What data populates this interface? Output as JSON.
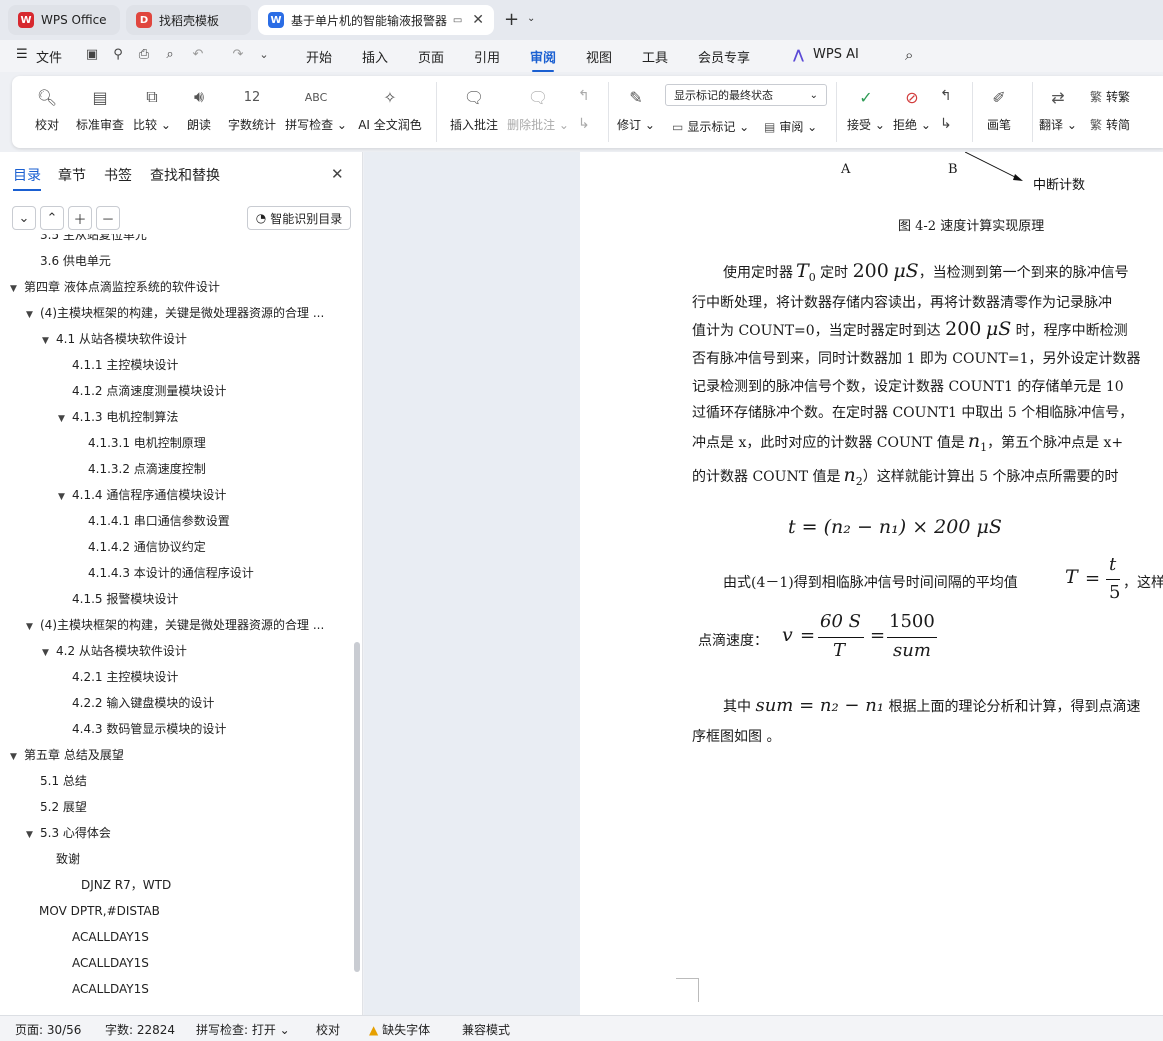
{
  "tabs": [
    {
      "label": "WPS Office",
      "icon": "W",
      "color": "#d7282f"
    },
    {
      "label": "找稻壳模板",
      "icon": "D",
      "color": "#e0463e"
    },
    {
      "label": "基于单片机的智能输液报警器",
      "icon": "W",
      "color": "#2b6de5"
    }
  ],
  "menu": {
    "file": "文件",
    "items": [
      "开始",
      "插入",
      "页面",
      "引用",
      "审阅",
      "视图",
      "工具",
      "会员专享"
    ],
    "active": "审阅",
    "ai": "WPS AI"
  },
  "ribbon": {
    "proofread": "校对",
    "standard_review": "标准审查",
    "compare": "比较",
    "read_aloud": "朗读",
    "word_count": "字数统计",
    "spell_check": "拼写检查",
    "ai_polish": "AI 全文润色",
    "insert_comment": "插入批注",
    "delete_comment": "删除批注",
    "revise": "修订",
    "track_mode": "显示标记的最终状态",
    "show_markup": "显示标记",
    "review": "审阅",
    "accept": "接受",
    "reject": "拒绝",
    "pen": "画笔",
    "translate": "翻译",
    "to_traditional": "转繁",
    "to_simplified": "转简"
  },
  "sidebar": {
    "tabs": [
      "目录",
      "章节",
      "书签",
      "查找和替换"
    ],
    "smart_toc": "智能识别目录",
    "toc": [
      {
        "text": "3.5  主从站复位单元",
        "level": 2
      },
      {
        "text": "3.6 供电单元",
        "level": 2
      },
      {
        "text": "第四章      液体点滴监控系统的软件设计",
        "level": 1,
        "arrow": "down"
      },
      {
        "text": "(4)主模块框架的构建，关键是微处理器资源的合理 ...",
        "level": 2,
        "arrow": "down"
      },
      {
        "text": "4.1 从站各模块软件设计",
        "level": 3,
        "arrow": "down"
      },
      {
        "text": "4.1.1 主控模块设计",
        "level": 4
      },
      {
        "text": "4.1.2 点滴速度测量模块设计",
        "level": 4
      },
      {
        "text": "4.1.3 电机控制算法",
        "level": 4,
        "arrow": "down"
      },
      {
        "text": "4.1.3.1  电机控制原理",
        "level": 5
      },
      {
        "text": "4.1.3.2 点滴速度控制",
        "level": 5
      },
      {
        "text": "4.1.4 通信程序通信模块设计",
        "level": 4,
        "arrow": "down"
      },
      {
        "text": "4.1.4.1 串口通信参数设置",
        "level": 5
      },
      {
        "text": "4.1.4.2 通信协议约定",
        "level": 5
      },
      {
        "text": "4.1.4.3 本设计的通信程序设计",
        "level": 5
      },
      {
        "text": "4.1.5 报警模块设计",
        "level": 4
      },
      {
        "text": "(4)主模块框架的构建，关键是微处理器资源的合理 ...",
        "level": 2,
        "arrow": "down"
      },
      {
        "text": "4.2  从站各模块软件设计",
        "level": 3,
        "arrow": "down"
      },
      {
        "text": "4.2.1  主控模块设计",
        "level": 4
      },
      {
        "text": "4.2.2  输入键盘模块的设计",
        "level": 4
      },
      {
        "text": "4.4.3    数码管显示模块的设计",
        "level": 4
      },
      {
        "text": "第五章    总结及展望",
        "level": 1,
        "arrow": "down"
      },
      {
        "text": "5.1 总结",
        "level": 2
      },
      {
        "text": "5.2  展望",
        "level": 2
      },
      {
        "text": "5.3 心得体会",
        "level": 2,
        "arrow": "down"
      },
      {
        "text": "致谢",
        "level": 3
      },
      {
        "text": "DJNZ    R7，WTD",
        "level": 3.6
      },
      {
        "text": "MOV      DPTR,#DISTAB",
        "level": 0
      },
      {
        "text": "ACALLDAY1S",
        "level": 4
      },
      {
        "text": "ACALLDAY1S",
        "level": 4
      },
      {
        "text": "ACALLDAY1S",
        "level": 4
      }
    ]
  },
  "document": {
    "fig_label_a": "A",
    "fig_label_b": "B",
    "fig_interrupt": "中断计数",
    "fig_caption": "图 4-2  速度计算实现原理",
    "para1_lines": [
      [
        "使用定时器",
        "T",
        "0",
        "定时",
        "200",
        "μS",
        "，当检测到第一个到来的脉冲信号"
      ],
      [
        "行中断处理，将计数器存储内容读出，再将计数器清零作为记录脉冲"
      ],
      [
        "值计为 COUNT=0，当定时器定时到达",
        "200",
        "μS",
        "时，程序中断检测"
      ],
      [
        "否有脉冲信号到来，同时计数器加 1 即为 COUNT=1，另外设定计数器"
      ],
      [
        "记录检测到的脉冲信号个数，设定计数器 COUNT1 的存储单元是 10"
      ],
      [
        "过循环存储脉冲个数。在定时器 COUNT1 中取出 5 个相临脉冲信号，"
      ],
      [
        "冲点是 x，此时对应的计数器 COUNT 值是",
        "n",
        "1",
        "，第五个脉冲点是 x+"
      ],
      [
        "的计数器 COUNT 值是",
        "n",
        "2",
        "）这样就能计算出 5 个脉冲点所需要的时"
      ]
    ],
    "formula1": "t = (n₂ − n₁) × 200 μS",
    "para2_prefix": "由式(4－1)得到相临脉冲信号时间间隔的平均值",
    "para2_suffix": "，这样",
    "avg_T": "T",
    "avg_num": "t",
    "avg_den": "5",
    "speed_label": "点滴速度：",
    "speed_v": "v",
    "speed_num1": "60 S",
    "speed_den1": "T",
    "speed_num2": "1500",
    "speed_den2": "sum",
    "para3_prefix": "其中",
    "para3_math": "sum  = n₂ − n₁",
    "para3_suffix": "根据上面的理论分析和计算，得到点滴速",
    "para3_line2": "序框图如图          。"
  },
  "status": {
    "page": "页面: 30/56",
    "words": "字数: 22824",
    "spell": "拼写检查: 打开",
    "proof": "校对",
    "missing_font": "缺失字体",
    "compat": "兼容模式"
  }
}
